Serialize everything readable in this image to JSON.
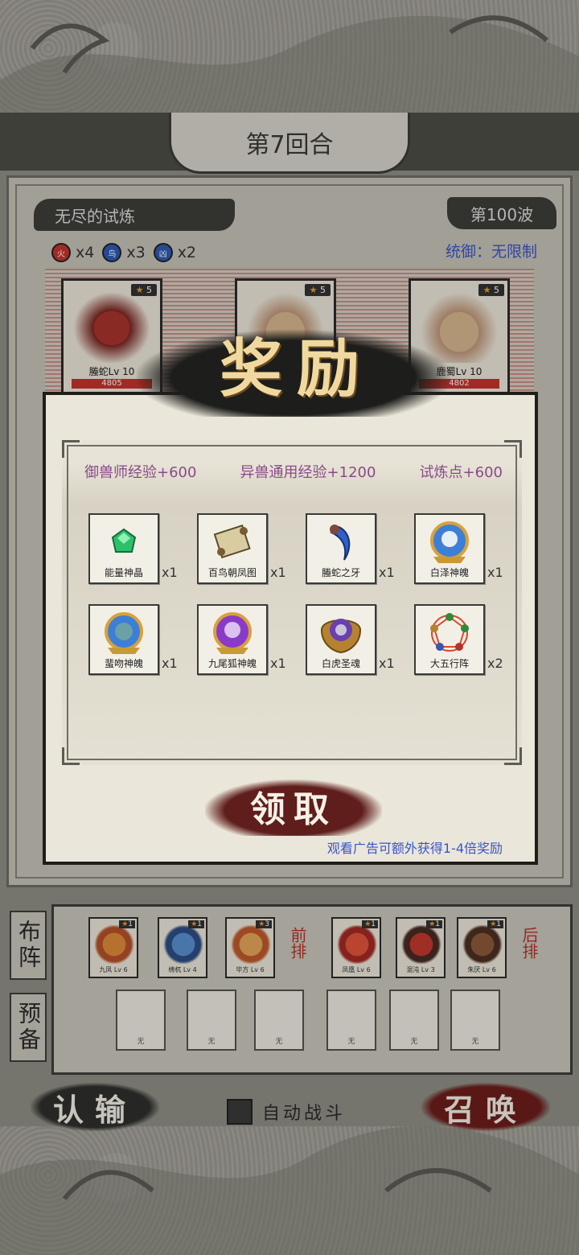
{
  "header": {
    "round": "第7回合"
  },
  "battle": {
    "stage_name": "无尽的试炼",
    "wave": "第100波",
    "command": "统御：无限制",
    "elements": [
      {
        "glyph": "火",
        "count": "x4",
        "color": "#c5352c"
      },
      {
        "glyph": "鸟",
        "count": "x3",
        "color": "#2f5bb5"
      },
      {
        "glyph": "凶",
        "count": "x2",
        "color": "#2f5bb5"
      }
    ],
    "enemies": [
      {
        "name": "螣蛇Lv 10",
        "stars": "5",
        "hp": "4805"
      },
      {
        "name": "",
        "stars": "5",
        "hp": ""
      },
      {
        "name": "鹿蜀Lv 10",
        "stars": "5",
        "hp": "4802"
      }
    ]
  },
  "reward": {
    "title_chars": [
      "奖",
      "励"
    ],
    "exp": [
      "御兽师经验+600",
      "异兽通用经验+1200",
      "试炼点+600"
    ],
    "items": [
      {
        "label": "能量神晶",
        "qty": "x1",
        "icon": "green-gem-icon"
      },
      {
        "label": "百鸟朝凤图",
        "qty": "x1",
        "icon": "scroll-icon"
      },
      {
        "label": "螣蛇之牙",
        "qty": "x1",
        "icon": "fang-icon"
      },
      {
        "label": "白泽神魄",
        "qty": "x1",
        "icon": "baize-soul-orb-icon"
      },
      {
        "label": "蜚吻神魄",
        "qty": "x1",
        "icon": "chiwen-soul-orb-icon"
      },
      {
        "label": "九尾狐神魄",
        "qty": "x1",
        "icon": "ninetail-soul-orb-icon"
      },
      {
        "label": "白虎圣魂",
        "qty": "x1",
        "icon": "white-tiger-soul-icon"
      },
      {
        "label": "大五行阵",
        "qty": "x2",
        "icon": "five-elements-array-icon"
      }
    ],
    "claim_label": "领取",
    "ad_hint": "观看广告可额外获得1-4倍奖励"
  },
  "formation": {
    "deploy_label": "布阵",
    "reserve_label": "预备",
    "front_tag": "前排",
    "back_tag": "后排",
    "front": [
      {
        "name": "九凤 Lv 6",
        "stars": "1"
      },
      {
        "name": "梼杌 Lv 4",
        "stars": "1"
      },
      {
        "name": "毕方 Lv 6",
        "stars": "3"
      }
    ],
    "back": [
      {
        "name": "凤凰 Lv 6",
        "stars": "1"
      },
      {
        "name": "混沌 Lv 3",
        "stars": "1"
      },
      {
        "name": "朱厌 Lv 6",
        "stars": "1"
      }
    ],
    "empty_label": "无"
  },
  "controls": {
    "surrender": "认输",
    "summon": "召唤",
    "auto_battle": "自动战斗"
  }
}
